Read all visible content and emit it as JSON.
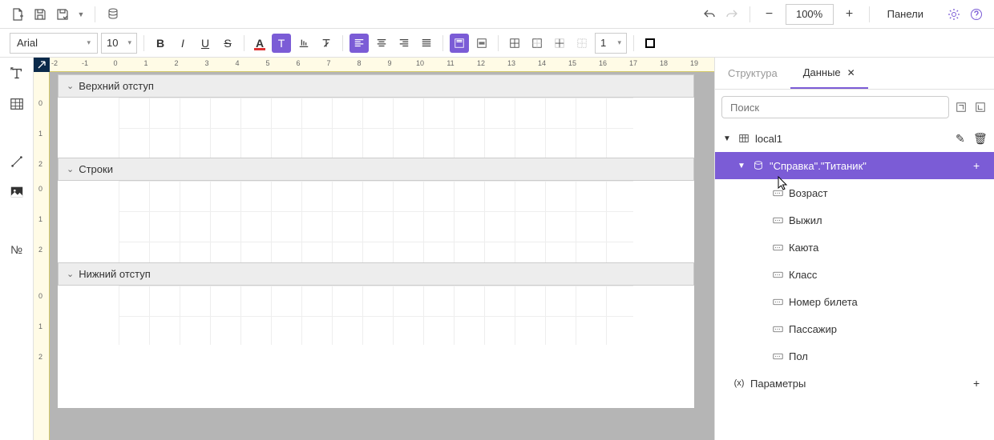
{
  "toolbar": {
    "zoom": "100%",
    "panels_label": "Панели"
  },
  "format": {
    "font": "Arial",
    "size": "10",
    "border_width": "1"
  },
  "ruler_h": [
    "-2",
    "-1",
    "0",
    "1",
    "2",
    "3",
    "4",
    "5",
    "6",
    "7",
    "8",
    "9",
    "10",
    "11",
    "12",
    "13",
    "14",
    "15",
    "16",
    "17",
    "18",
    "19"
  ],
  "ruler_v_sections": [
    {
      "labels": [
        "0",
        "1",
        "2"
      ]
    },
    {
      "labels": [
        "0",
        "1",
        "2"
      ]
    },
    {
      "labels": [
        "0",
        "1",
        "2"
      ]
    }
  ],
  "bands": [
    {
      "title": "Верхний отступ",
      "body_h": 75
    },
    {
      "title": "Строки",
      "body_h": 102
    },
    {
      "title": "Нижний отступ",
      "body_h": 74
    }
  ],
  "right": {
    "tabs": {
      "structure": "Структура",
      "data": "Данные"
    },
    "search_placeholder": "Поиск",
    "datasource": "local1",
    "table": "\"Справка\".\"Титаник\"",
    "fields": [
      "Возраст",
      "Выжил",
      "Каюта",
      "Класс",
      "Номер билета",
      "Пассажир",
      "Пол"
    ],
    "params": "Параметры"
  }
}
